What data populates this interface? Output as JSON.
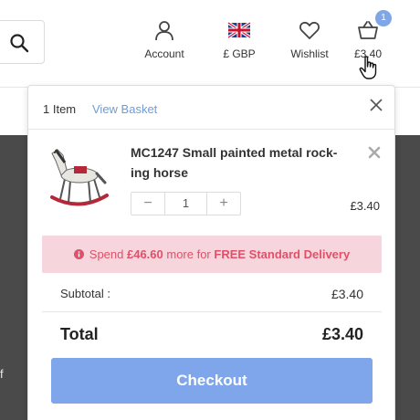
{
  "header": {
    "account_label": "Account",
    "currency_label": "£ GBP",
    "wishlist_label": "Wishlist",
    "basket_label": "£3.40",
    "basket_badge": "1"
  },
  "background": {
    "edge_text": "f"
  },
  "cart": {
    "item_count": "1 Item",
    "view_basket": "View Basket",
    "product": {
      "title": "MC1247 Small painted metal rock-ing horse",
      "quantity": "1",
      "price": "£3.40"
    },
    "delivery": {
      "prefix": "Spend ",
      "amount": "£46.60",
      "middle": " more for ",
      "offer": "FREE Standard Delivery"
    },
    "subtotal_label": "Subtotal :",
    "subtotal_value": "£3.40",
    "total_label": "Total",
    "total_value": "£3.40",
    "checkout_label": "Checkout"
  },
  "colors": {
    "accent": "#7fa6ea",
    "link": "#6f9bd6",
    "delivery_bg": "#f6d6dc",
    "delivery_text": "#e0506a",
    "overlay": "#4a4a4a"
  },
  "icons": [
    "search-icon",
    "account-icon",
    "uk-flag-icon",
    "heart-icon",
    "basket-icon",
    "hand-cursor-icon",
    "close-icon",
    "remove-icon",
    "info-icon"
  ]
}
